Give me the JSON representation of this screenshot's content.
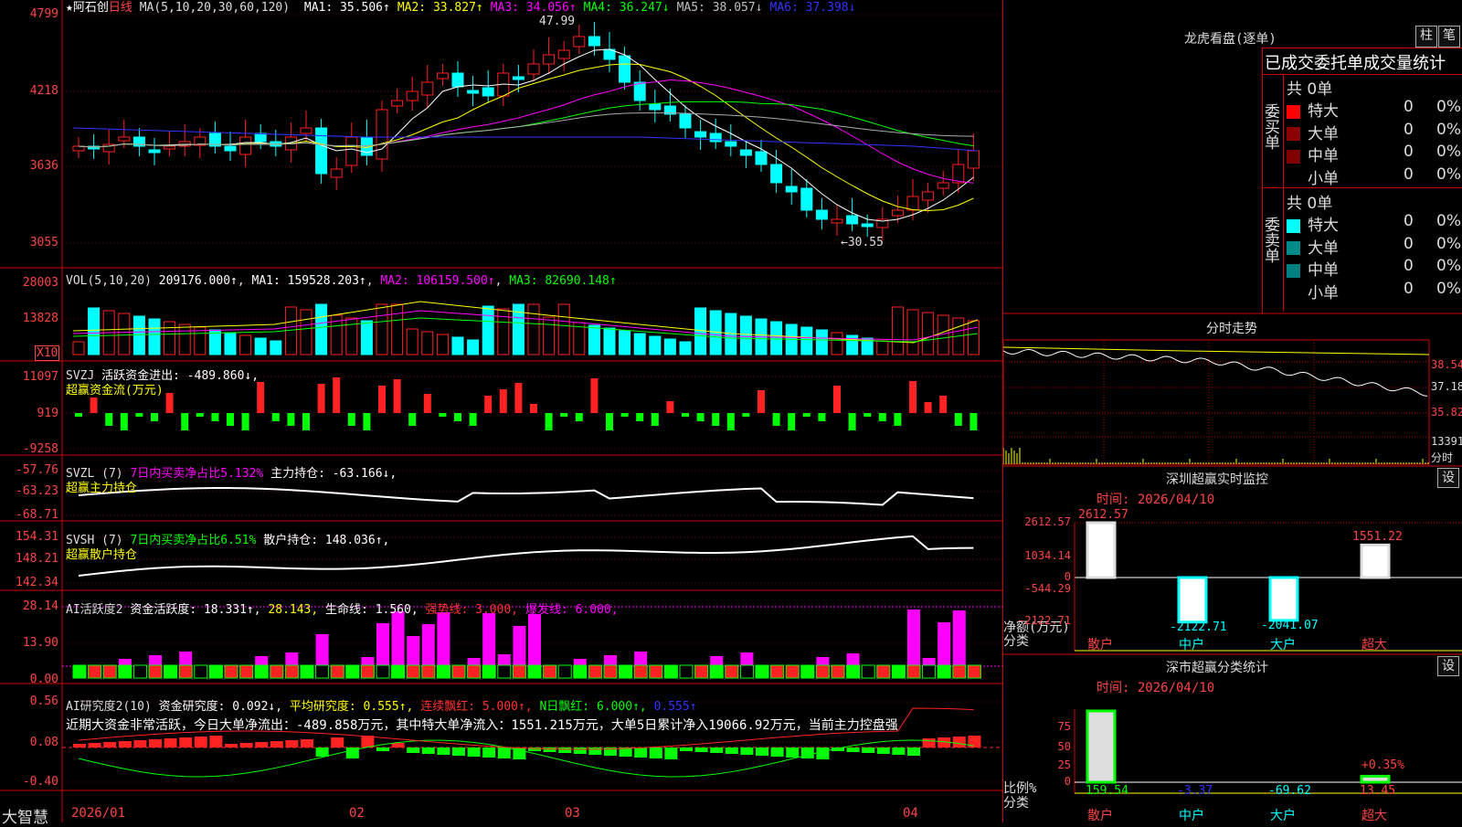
{
  "stock": {
    "star": "★",
    "name": "阿石创",
    "period": "日线",
    "ma_label": "MA(5,10,20,30,60,120)"
  },
  "kline": {
    "ma_values": [
      {
        "label": "MA1: 35.506↑",
        "color": "#ffffff"
      },
      {
        "label": "MA2: 33.827↑",
        "color": "#ffff00"
      },
      {
        "label": "MA3: 34.056↑",
        "color": "#ff00ff"
      },
      {
        "label": "MA4: 36.247↓",
        "color": "#00ff00"
      },
      {
        "label": "MA5: 38.057↓",
        "color": "#c0c0c0"
      },
      {
        "label": "MA6: 37.398↓",
        "color": "#3333ff"
      }
    ],
    "y_ticks": [
      "4799",
      "4218",
      "3636",
      "3055"
    ],
    "high_annotation": "47.99",
    "low_annotation": "←30.55"
  },
  "vol": {
    "title": "VOL(5,10,20)",
    "value": "209176.000↑",
    "ma1": "MA1: 159528.203↑",
    "ma2": "MA2: 106159.500↑",
    "ma3": "MA3: 82690.148↑",
    "y_ticks": [
      "28003",
      "13828"
    ],
    "unit": "X10"
  },
  "svzj": {
    "title": "SVZJ",
    "desc": "活跃资金进出: -489.860↓,",
    "name": "超赢资金流(万元)",
    "y_ticks": [
      "11097",
      "919",
      "-9258"
    ]
  },
  "svzl": {
    "title": "SVZL (7)",
    "pct": "7日内买卖净占比5.132%",
    "desc": "主力持仓: -63.166↓,",
    "name": "超赢主力持仓",
    "y_ticks": [
      "-57.76",
      "-63.23",
      "-68.71"
    ]
  },
  "svsh": {
    "title": "SVSH (7)",
    "pct": "7日内买卖净占比6.51%",
    "desc": "散户持仓: 148.036↑,",
    "name": "超赢散户持仓",
    "y_ticks": [
      "154.31",
      "148.21",
      "142.34"
    ]
  },
  "ai1": {
    "title": "AI活跃度2",
    "desc": "资金活跃度: 18.331↑,",
    "v2": "28.143,",
    "life": "生命线: 1.560,",
    "strong": "强势线: 3.000,",
    "burst": "爆发线: 6.000,",
    "y_ticks": [
      "28.14",
      "13.90",
      "0.00"
    ]
  },
  "ai2": {
    "title": "AI研究度2(10)",
    "desc": "资金研究度: 0.092↓,",
    "avg": "平均研究度: 0.555↑,",
    "red": "连续飘红: 5.000↑,",
    "nred": "N日飘红: 6.000↑,",
    "v": "0.555↑",
    "comment": "近期大资金非常活跃，今日大单净流出：-489.858万元，其中特大单净流入：1551.215万元，大单5日累计净入19066.92万元，当前主力控盘强",
    "y_ticks": [
      "0.56",
      "0.08",
      "-0.40"
    ]
  },
  "x_axis": {
    "labels": [
      "2026/01",
      "02",
      "03",
      "04"
    ]
  },
  "footer_brand": "大智慧",
  "lhkp": {
    "title": "龙虎看盘(逐单)",
    "btn1": "柱",
    "btn2": "笔",
    "tab": "已成交委托单成交量统计",
    "buy": {
      "label": "委买单",
      "total": "共 0单",
      "rows": [
        {
          "name": "特大",
          "v": "0",
          "p": "0%",
          "color": "#ff0000"
        },
        {
          "name": "大单",
          "v": "0",
          "p": "0%",
          "color": "#8b0000"
        },
        {
          "name": "中单",
          "v": "0",
          "p": "0%",
          "color": "#800000"
        },
        {
          "name": "小单",
          "v": "0",
          "p": "0%",
          "color": "#000000"
        }
      ]
    },
    "sell": {
      "label": "委卖单",
      "total": "共 0单",
      "rows": [
        {
          "name": "特大",
          "v": "0",
          "p": "0%",
          "color": "#00ffff"
        },
        {
          "name": "大单",
          "v": "0",
          "p": "0%",
          "color": "#008b8b"
        },
        {
          "name": "中单",
          "v": "0",
          "p": "0%",
          "color": "#008080"
        },
        {
          "name": "小单",
          "v": "0",
          "p": "0%",
          "color": "#000000"
        }
      ]
    }
  },
  "fenshi": {
    "title": "分时走势",
    "y_ticks": [
      "38.54",
      "37.18",
      "35.82"
    ],
    "vol_tick": "13391",
    "unit": "分时"
  },
  "sz_monitor": {
    "title": "深圳超赢实时监控",
    "btn": "设",
    "time": "时间: 2026/04/10",
    "y_ticks": [
      "2612.57",
      "1034.14",
      "0",
      "-544.29",
      "-2122.71"
    ],
    "axis_label": "净额(万元)",
    "cat_label": "分类",
    "bars": [
      {
        "name": "散户",
        "value": 2612.57,
        "label": "2612.57"
      },
      {
        "name": "中户",
        "value": -2122.71,
        "label": "-2122.71"
      },
      {
        "name": "大户",
        "value": -2041.07,
        "label": "-2041.07"
      },
      {
        "name": "超大",
        "value": 1551.22,
        "label": "1551.22"
      }
    ]
  },
  "sz_class": {
    "title": "深市超赢分类统计",
    "btn": "设",
    "time": "时间: 2026/04/10",
    "y_ticks": [
      "75",
      "50",
      "25",
      "0"
    ],
    "axis_label": "比例%",
    "cat_label": "分类",
    "extra": "+0.35%",
    "bars": [
      {
        "name": "散户",
        "value": 159.54,
        "label": "159.54"
      },
      {
        "name": "中户",
        "value": -3.37,
        "label": "-3.37"
      },
      {
        "name": "大户",
        "value": -69.62,
        "label": "-69.62"
      },
      {
        "name": "超大",
        "value": 13.45,
        "label": "13.45"
      }
    ]
  }
}
